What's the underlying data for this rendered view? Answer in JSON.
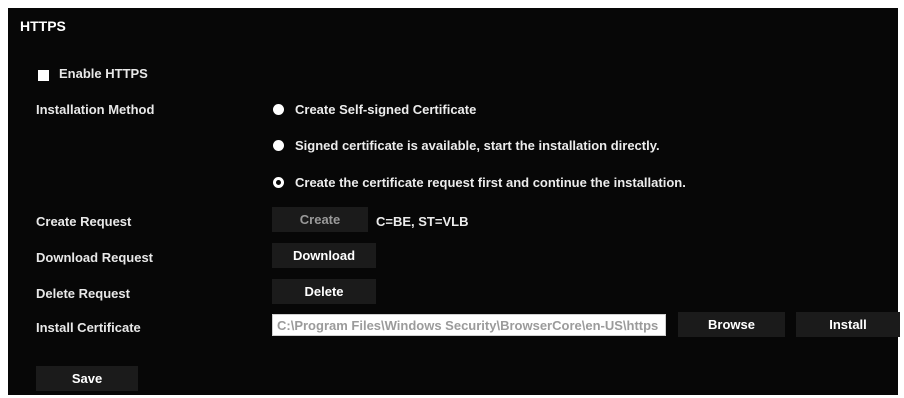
{
  "page": {
    "title": "HTTPS"
  },
  "enable_https": {
    "label": "Enable HTTPS",
    "checked": false
  },
  "installation_method": {
    "label": "Installation Method",
    "options": [
      {
        "label": "Create Self-signed Certificate",
        "selected": false
      },
      {
        "label": "Signed certificate is available, start the installation directly.",
        "selected": false
      },
      {
        "label": "Create the certificate request first and continue the installation.",
        "selected": true
      }
    ]
  },
  "create_request": {
    "label": "Create Request",
    "button_label": "Create",
    "button_enabled": false,
    "value": "C=BE, ST=VLB"
  },
  "download_request": {
    "label": "Download Request",
    "button_label": "Download"
  },
  "delete_request": {
    "label": "Delete Request",
    "button_label": "Delete"
  },
  "install_certificate": {
    "label": "Install Certificate",
    "path_value": "C:\\Program Files\\Windows Security\\BrowserCore\\en-US\\https",
    "browse_label": "Browse",
    "install_label": "Install"
  },
  "save": {
    "label": "Save"
  }
}
